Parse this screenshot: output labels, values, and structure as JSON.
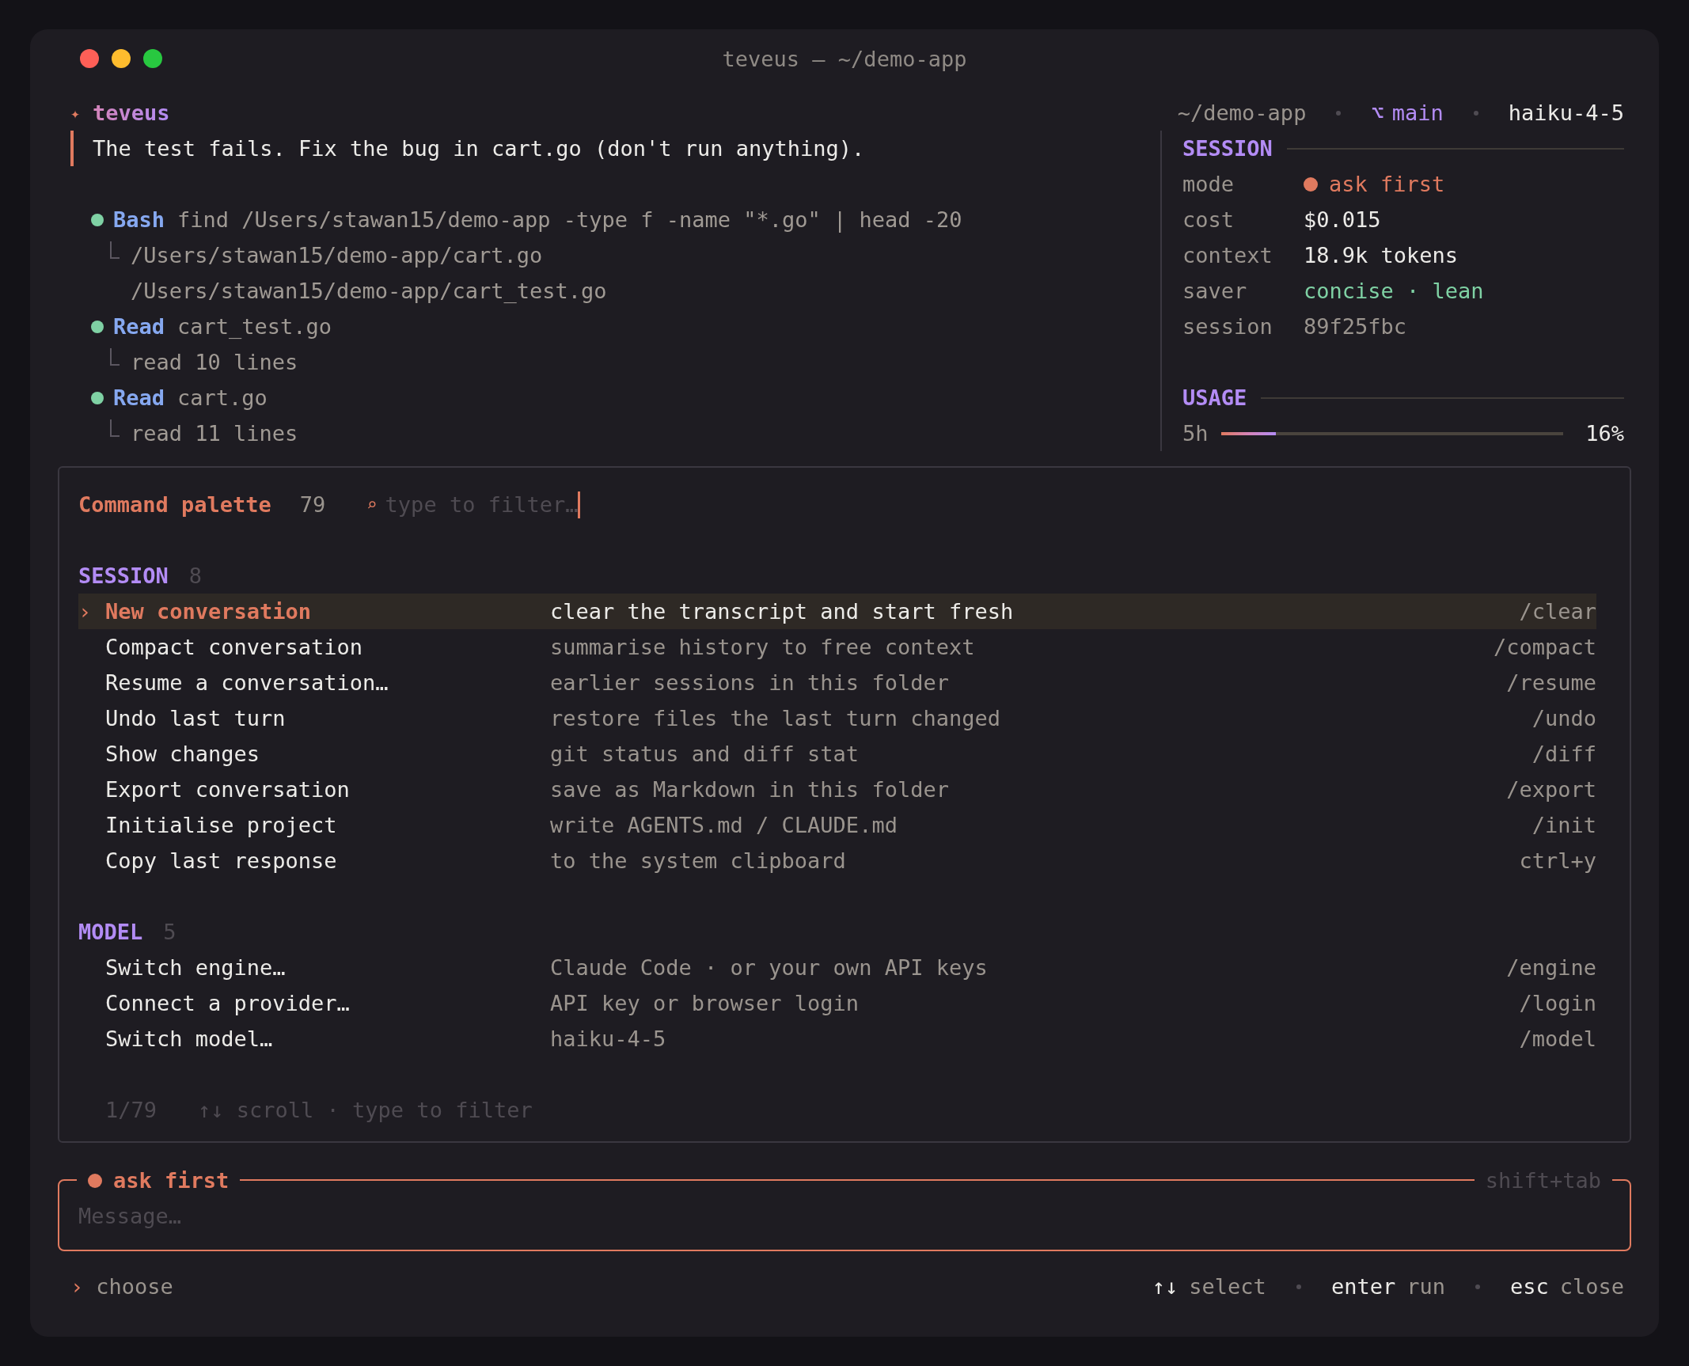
{
  "window": {
    "title": "teveus — ~/demo-app"
  },
  "header": {
    "glyph": "✦",
    "app_name": "teveus",
    "prompt": "The test fails. Fix the bug in cart.go (don't run anything)."
  },
  "tool_calls": [
    {
      "tool": "Bash",
      "args": "find /Users/stawan15/demo-app -type f -name \"*.go\" | head -20",
      "output": [
        "/Users/stawan15/demo-app/cart.go",
        "/Users/stawan15/demo-app/cart_test.go"
      ]
    },
    {
      "tool": "Read",
      "args": "cart_test.go",
      "output": [
        "read 10 lines"
      ]
    },
    {
      "tool": "Read",
      "args": "cart.go",
      "output": [
        "read 11 lines"
      ]
    }
  ],
  "status": {
    "path": "~/demo-app",
    "branch_icon": "⌥",
    "branch": "main",
    "model": "haiku-4-5"
  },
  "session_panel": {
    "heading": "SESSION",
    "rows": [
      {
        "label": "mode",
        "value": "ask first",
        "kind": "mode"
      },
      {
        "label": "cost",
        "value": "$0.015",
        "kind": "value"
      },
      {
        "label": "context",
        "value": "18.9k tokens",
        "kind": "value"
      },
      {
        "label": "saver",
        "value": "concise · lean",
        "kind": "accent"
      },
      {
        "label": "session",
        "value": "89f25fbc",
        "kind": "muted"
      }
    ]
  },
  "usage": {
    "heading": "USAGE",
    "label": "5h",
    "level": 0.16,
    "reading": "16%"
  },
  "palette": {
    "title": "Command palette",
    "count": "79",
    "search_glyph": "⌕",
    "placeholder": "type to filter…",
    "cursor": "›",
    "groups": [
      {
        "name": "SESSION",
        "count": "8",
        "items": [
          {
            "label": "New conversation",
            "description": "clear the transcript and start fresh",
            "shortcut": "/clear",
            "selected": true
          },
          {
            "label": "Compact conversation",
            "description": "summarise history to free context",
            "shortcut": "/compact",
            "selected": false
          },
          {
            "label": "Resume a conversation…",
            "description": "earlier sessions in this folder",
            "shortcut": "/resume",
            "selected": false
          },
          {
            "label": "Undo last turn",
            "description": "restore files the last turn changed",
            "shortcut": "/undo",
            "selected": false
          },
          {
            "label": "Show changes",
            "description": "git status and diff stat",
            "shortcut": "/diff",
            "selected": false
          },
          {
            "label": "Export conversation",
            "description": "save as Markdown in this folder",
            "shortcut": "/export",
            "selected": false
          },
          {
            "label": "Initialise project",
            "description": "write AGENTS.md / CLAUDE.md",
            "shortcut": "/init",
            "selected": false
          },
          {
            "label": "Copy last response",
            "description": "to the system clipboard",
            "shortcut": "ctrl+y",
            "selected": false
          }
        ]
      },
      {
        "name": "MODEL",
        "count": "5",
        "items": [
          {
            "label": "Switch engine…",
            "description": "Claude Code · or your own API keys",
            "shortcut": "/engine",
            "selected": false
          },
          {
            "label": "Connect a provider…",
            "description": "API key or browser login",
            "shortcut": "/login",
            "selected": false
          },
          {
            "label": "Switch model…",
            "description": "haiku-4-5",
            "shortcut": "/model",
            "selected": false
          }
        ]
      }
    ],
    "position": "1/79",
    "hint": "↑↓ scroll · type to filter"
  },
  "input": {
    "mode": "ask first",
    "hint": "shift+tab",
    "placeholder": "Message…"
  },
  "footer": {
    "prompt_glyph": "›",
    "label": "choose",
    "keys": [
      {
        "key": "↑↓",
        "action": "select"
      },
      {
        "key": "enter",
        "action": "run"
      },
      {
        "key": "esc",
        "action": "close"
      }
    ]
  }
}
